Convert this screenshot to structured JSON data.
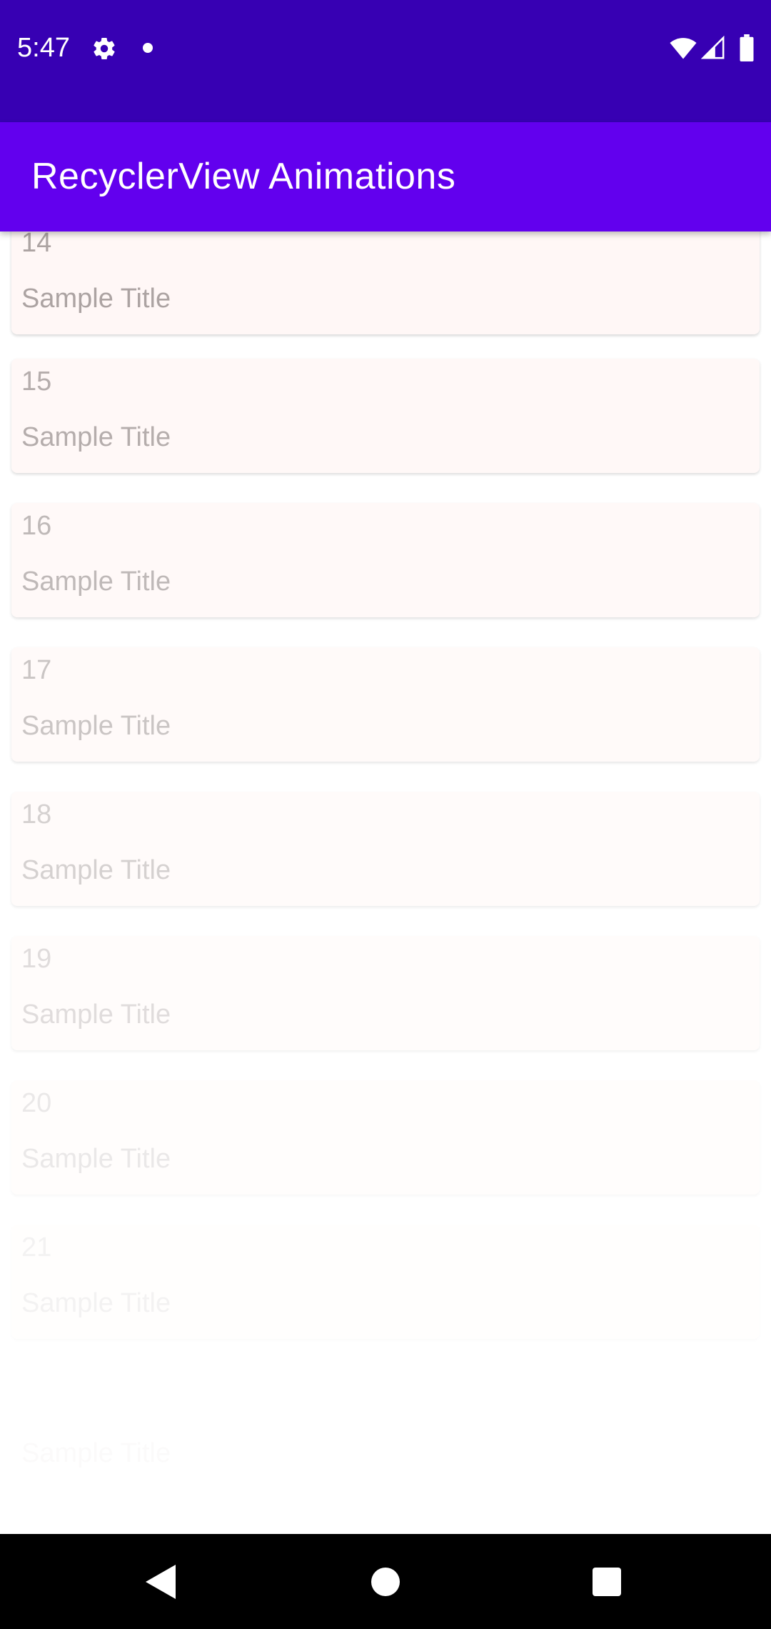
{
  "status_bar": {
    "time": "5:47",
    "icons": [
      "gear-icon",
      "notification-dot-icon",
      "wifi-icon",
      "cell-signal-icon",
      "battery-icon"
    ]
  },
  "app_bar": {
    "title": "RecyclerView Animations"
  },
  "list": {
    "items": [
      {
        "number": "14",
        "title": "Sample Title",
        "opacity": 0.92
      },
      {
        "number": "15",
        "title": "Sample Title",
        "opacity": 0.82
      },
      {
        "number": "16",
        "title": "Sample Title",
        "opacity": 0.7
      },
      {
        "number": "17",
        "title": "Sample Title",
        "opacity": 0.58
      },
      {
        "number": "18",
        "title": "Sample Title",
        "opacity": 0.46
      },
      {
        "number": "19",
        "title": "Sample Title",
        "opacity": 0.34
      },
      {
        "number": "20",
        "title": "Sample Title",
        "opacity": 0.22
      },
      {
        "number": "21",
        "title": "Sample Title",
        "opacity": 0.12
      }
    ],
    "trailing_ghost_title": "Sample Title"
  },
  "nav_bar": {
    "buttons": [
      "back-icon",
      "home-icon",
      "recents-icon"
    ]
  },
  "colors": {
    "status_bar": "#3700B3",
    "app_bar": "#6200EE",
    "card_background": "#fff7f6",
    "card_text": "#a59c9b",
    "nav_bar": "#000000"
  }
}
